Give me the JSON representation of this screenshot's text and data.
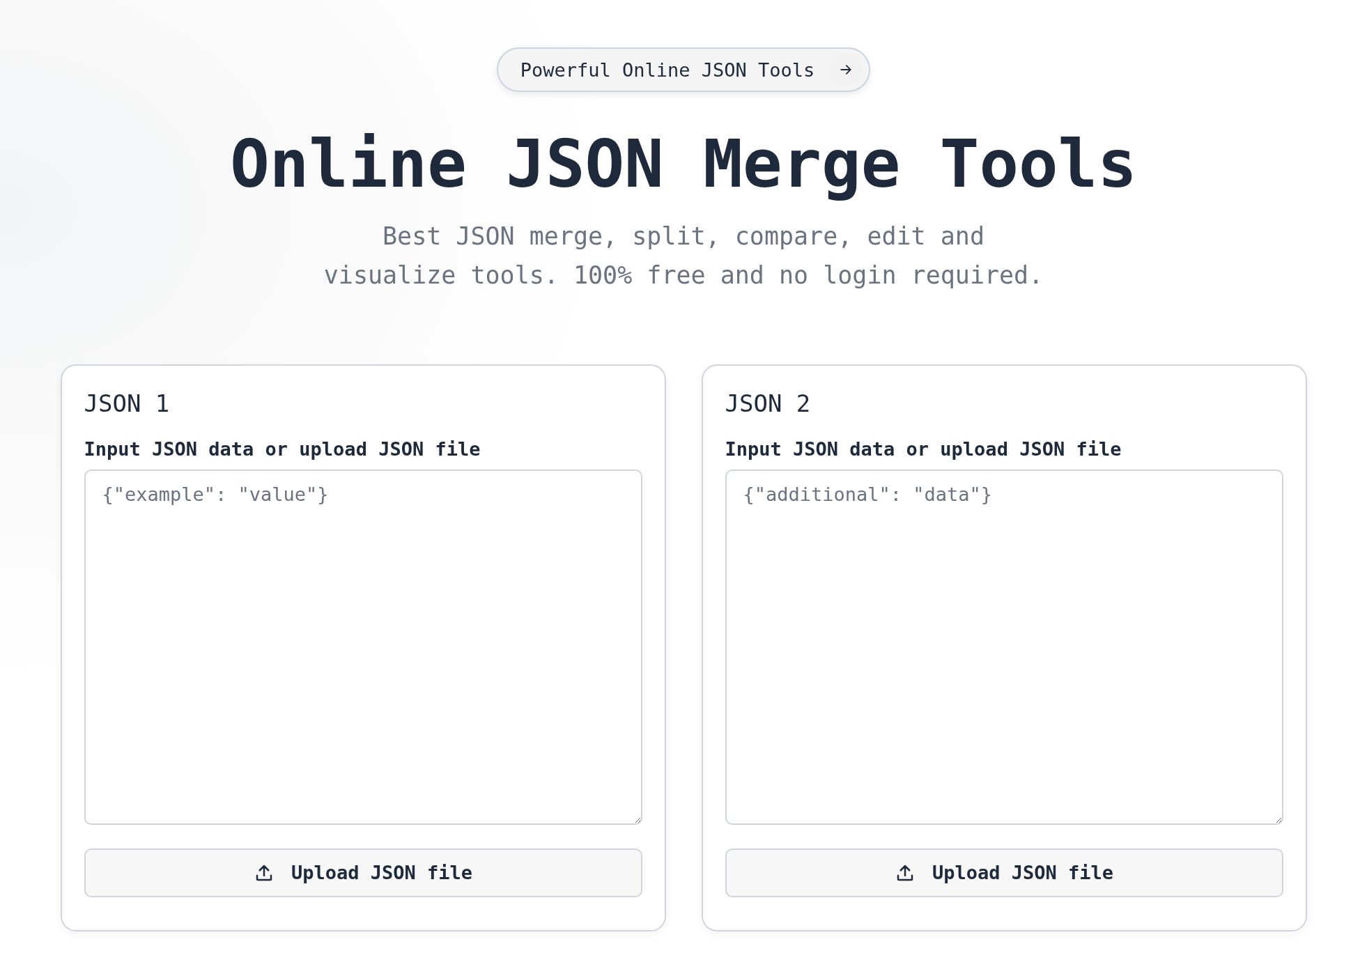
{
  "announcement": {
    "label": "Powerful Online JSON Tools"
  },
  "hero": {
    "title": "Online JSON Merge Tools",
    "subtitle_lines": [
      "Best JSON merge, split, compare, edit and",
      "visualize tools. 100% free and no login required."
    ]
  },
  "panels": [
    {
      "title": "JSON 1",
      "field_label": "Input JSON data or upload JSON file",
      "placeholder": "{\"example\": \"value\"}",
      "button": "Upload JSON file"
    },
    {
      "title": "JSON 2",
      "field_label": "Input JSON data or upload JSON file",
      "placeholder": "{\"additional\": \"data\"}",
      "button": "Upload JSON file"
    }
  ]
}
